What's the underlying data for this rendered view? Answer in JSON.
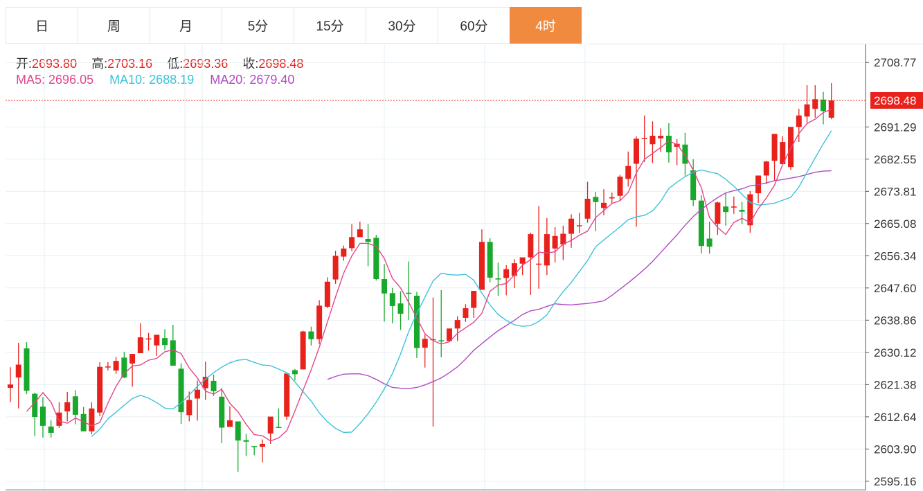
{
  "tabs": [
    {
      "label": "日"
    },
    {
      "label": "周"
    },
    {
      "label": "月"
    },
    {
      "label": "5分"
    },
    {
      "label": "15分"
    },
    {
      "label": "30分"
    },
    {
      "label": "60分"
    },
    {
      "label": "4时"
    }
  ],
  "active_tab": 7,
  "ohlc": {
    "open_label": "开:",
    "open": "2693.80",
    "high_label": "高:",
    "high": "2703.16",
    "low_label": "低:",
    "low": "2693.36",
    "close_label": "收:",
    "close": "2698.48"
  },
  "ma": {
    "ma5_label": "MA5:",
    "ma5": "2696.05",
    "ma10_label": "MA10:",
    "ma10": "2688.19",
    "ma20_label": "MA20:",
    "ma20": "2679.40"
  },
  "colors": {
    "up": "#e8211b",
    "down": "#18a82b",
    "ma5": "#e2478a",
    "ma10": "#3cc3d9",
    "ma20": "#b04bc4",
    "accent": "#f08a3e",
    "grid": "#e6eff4"
  },
  "chart_data": {
    "type": "candlestick",
    "y_ticks": [
      "2708.77",
      "2691.29",
      "2682.55",
      "2673.81",
      "2665.08",
      "2656.34",
      "2647.60",
      "2638.86",
      "2630.12",
      "2621.38",
      "2612.64",
      "2603.90",
      "2595.16"
    ],
    "ylim": [
      2592.7,
      2713.7
    ],
    "last_price": "2698.48",
    "candles": [
      [
        2620.5,
        2626.1,
        2616.6,
        2621.4
      ],
      [
        2623.3,
        2632.7,
        2614.9,
        2626.8
      ],
      [
        2631.2,
        2632.9,
        2618.8,
        2619.7
      ],
      [
        2618.9,
        2619.2,
        2607.4,
        2612.6
      ],
      [
        2615.4,
        2618.0,
        2607.0,
        2610.2
      ],
      [
        2610.0,
        2611.7,
        2607.0,
        2608.3
      ],
      [
        2610.2,
        2616.6,
        2609.6,
        2613.8
      ],
      [
        2614.1,
        2619.4,
        2611.4,
        2616.6
      ],
      [
        2618.2,
        2619.9,
        2610.6,
        2613.2
      ],
      [
        2613.4,
        2615.3,
        2608.7,
        2608.7
      ],
      [
        2608.7,
        2616.6,
        2607.9,
        2614.9
      ],
      [
        2613.8,
        2627.5,
        2612.8,
        2626.2
      ],
      [
        2626.3,
        2627.5,
        2625.2,
        2626.3
      ],
      [
        2625.2,
        2628.9,
        2624.3,
        2627.8
      ],
      [
        2628.7,
        2630.3,
        2623.1,
        2623.3
      ],
      [
        2627.1,
        2629.7,
        2620.8,
        2629.7
      ],
      [
        2629.9,
        2638.0,
        2630.1,
        2634.2
      ],
      [
        2633.8,
        2635.4,
        2630.6,
        2633.9
      ],
      [
        2632.0,
        2634.9,
        2629.2,
        2634.9
      ],
      [
        2634.0,
        2636.4,
        2630.8,
        2632.1
      ],
      [
        2633.4,
        2637.6,
        2630.6,
        2626.5
      ],
      [
        2625.7,
        2627.2,
        2610.7,
        2613.9
      ],
      [
        2613.1,
        2619.5,
        2611.4,
        2617.2
      ],
      [
        2617.6,
        2622.5,
        2611.6,
        2620.0
      ],
      [
        2620.4,
        2627.6,
        2617.2,
        2623.5
      ],
      [
        2622.4,
        2624.1,
        2618.3,
        2619.6
      ],
      [
        2618.1,
        2620.5,
        2605.5,
        2609.7
      ],
      [
        2609.9,
        2615.5,
        2610.1,
        2611.7
      ],
      [
        2611.4,
        2611.4,
        2597.7,
        2606.2
      ],
      [
        2606.3,
        2608.0,
        2602.0,
        2605.9
      ],
      [
        2604.7,
        2604.7,
        2602.2,
        2604.5
      ],
      [
        2604.5,
        2606.5,
        2600.3,
        2605.3
      ],
      [
        2608.1,
        2611.9,
        2605.3,
        2612.7
      ],
      [
        2609.9,
        2614.9,
        2609.6,
        2609.6
      ],
      [
        2612.7,
        2617.7,
        2611.8,
        2624.4
      ],
      [
        2625.3,
        2625.6,
        2622.5,
        2624.2
      ],
      [
        2625.5,
        2636.0,
        2625.5,
        2635.8
      ],
      [
        2635.8,
        2637.1,
        2632.0,
        2633.7
      ],
      [
        2633.7,
        2644.3,
        2632.3,
        2642.8
      ],
      [
        2642.5,
        2650.5,
        2642.1,
        2649.3
      ],
      [
        2649.9,
        2657.7,
        2648.7,
        2656.3
      ],
      [
        2656.1,
        2659.1,
        2655.0,
        2658.3
      ],
      [
        2658.4,
        2664.9,
        2657.6,
        2661.4
      ],
      [
        2661.4,
        2665.6,
        2661.4,
        2663.5
      ],
      [
        2660.9,
        2664.9,
        2653.5,
        2660.1
      ],
      [
        2661.2,
        2662.0,
        2649.6,
        2650.0
      ],
      [
        2650.0,
        2654.1,
        2638.5,
        2646.1
      ],
      [
        2646.2,
        2647.6,
        2638.0,
        2642.7
      ],
      [
        2643.4,
        2646.7,
        2636.2,
        2640.6
      ],
      [
        2646.3,
        2654.8,
        2638.9,
        2646.0
      ],
      [
        2645.5,
        2646.5,
        2628.6,
        2631.3
      ],
      [
        2631.4,
        2635.0,
        2626.0,
        2633.8
      ],
      [
        2633.6,
        2645.0,
        2610.0,
        2633.7
      ],
      [
        2633.4,
        2647.0,
        2628.8,
        2633.3
      ],
      [
        2633.2,
        2636.6,
        2633.2,
        2636.6
      ],
      [
        2636.6,
        2639.9,
        2633.2,
        2638.9
      ],
      [
        2639.5,
        2643.2,
        2638.4,
        2642.1
      ],
      [
        2642.2,
        2646.6,
        2639.5,
        2646.8
      ],
      [
        2647.1,
        2663.5,
        2647.1,
        2660.1
      ],
      [
        2660.1,
        2661.1,
        2649.1,
        2650.4
      ],
      [
        2650.2,
        2654.5,
        2645.5,
        2649.9
      ],
      [
        2650.3,
        2653.8,
        2645.6,
        2652.7
      ],
      [
        2650.9,
        2655.4,
        2647.6,
        2654.3
      ],
      [
        2654.2,
        2655.7,
        2651.1,
        2655.9
      ],
      [
        2655.9,
        2662.6,
        2645.7,
        2662.2
      ],
      [
        2654.2,
        2669.8,
        2647.4,
        2654.2
      ],
      [
        2653.7,
        2666.6,
        2651.1,
        2662.2
      ],
      [
        2658.3,
        2664.1,
        2654.5,
        2661.7
      ],
      [
        2659.4,
        2664.5,
        2655.2,
        2662.3
      ],
      [
        2662.3,
        2667.6,
        2658.5,
        2666.4
      ],
      [
        2664.6,
        2668.0,
        2662.5,
        2664.6
      ],
      [
        2666.4,
        2676.4,
        2665.3,
        2671.8
      ],
      [
        2672.3,
        2673.7,
        2663.0,
        2670.9
      ],
      [
        2669.3,
        2674.4,
        2667.3,
        2670.7
      ],
      [
        2671.9,
        2673.5,
        2670.4,
        2672.2
      ],
      [
        2672.6,
        2678.3,
        2671.3,
        2677.8
      ],
      [
        2677.2,
        2684.6,
        2675.1,
        2680.7
      ],
      [
        2681.3,
        2688.7,
        2664.2,
        2688.1
      ],
      [
        2688.1,
        2694.4,
        2681.8,
        2688.3
      ],
      [
        2686.6,
        2692.8,
        2681.5,
        2688.9
      ],
      [
        2688.2,
        2690.9,
        2684.5,
        2688.9
      ],
      [
        2688.9,
        2692.3,
        2681.6,
        2684.4
      ],
      [
        2685.9,
        2688.0,
        2680.9,
        2686.7
      ],
      [
        2686.5,
        2689.7,
        2678.1,
        2681.3
      ],
      [
        2679.5,
        2682.5,
        2669.8,
        2671.4
      ],
      [
        2671.3,
        2672.8,
        2656.9,
        2659.0
      ],
      [
        2661.0,
        2665.6,
        2656.9,
        2658.8
      ],
      [
        2665.0,
        2671.0,
        2662.0,
        2670.8
      ],
      [
        2669.7,
        2673.5,
        2664.5,
        2668.2
      ],
      [
        2669.6,
        2672.4,
        2667.7,
        2669.7
      ],
      [
        2668.8,
        2671.0,
        2664.9,
        2668.3
      ],
      [
        2664.6,
        2673.9,
        2662.6,
        2673.0
      ],
      [
        2673.3,
        2677.1,
        2670.6,
        2678.1
      ],
      [
        2678.1,
        2682.1,
        2675.8,
        2681.9
      ],
      [
        2682.1,
        2688.8,
        2676.7,
        2689.4
      ],
      [
        2681.2,
        2688.8,
        2681.2,
        2687.2
      ],
      [
        2680.4,
        2690.4,
        2679.6,
        2691.3
      ],
      [
        2691.3,
        2696.2,
        2687.2,
        2694.4
      ],
      [
        2694.1,
        2702.6,
        2692.4,
        2697.4
      ],
      [
        2696.2,
        2702.6,
        2693.8,
        2698.8
      ],
      [
        2698.7,
        2700.8,
        2692.0,
        2695.6
      ],
      [
        2693.8,
        2703.16,
        2693.36,
        2698.48
      ]
    ],
    "ma5": [
      2614.1,
      2616.5,
      2619.2,
      2616.6,
      2611.5,
      2610.9,
      2612.3,
      2611.3,
      2610.2,
      2611.1,
      2616.4,
      2620.9,
      2624.4,
      2626.4,
      2626.7,
      2628.0,
      2628.5,
      2630.3,
      2630.8,
      2629.8,
      2625.9,
      2623.2,
      2619.6,
      2618.8,
      2620.1,
      2616.3,
      2614.0,
      2610.6,
      2607.8,
      2607.5,
      2606.1,
      2606.9,
      2608.9,
      2614.2,
      2619.8,
      2625.4,
      2631.5,
      2638.4,
      2645.2,
      2651.6,
      2656.3,
      2659.7,
      2659.7,
      2658.9,
      2655.6,
      2650.2,
      2647.6,
      2643.7,
      2639.4,
      2635.2,
      2633.3,
      2632.4,
      2633.0,
      2635.3,
      2636.8,
      2638.3,
      2640.7,
      2646.7,
      2648.4,
      2648.8,
      2651.1,
      2653.8,
      2655.3,
      2657.3,
      2657.1,
      2657.4,
      2659.5,
      2660.5,
      2661.9,
      2663.0,
      2666.7,
      2668.6,
      2670.5,
      2671.3,
      2673.5,
      2678.8,
      2682.5,
      2684.1,
      2685.7,
      2687.5,
      2686.5,
      2683.7,
      2679.5,
      2674.8,
      2666.7,
      2664.0,
      2662.1,
      2665.4,
      2666.5,
      2665.3,
      2669.1,
      2672.0,
      2675.5,
      2681.1,
      2685.5,
      2689.5,
      2692.2,
      2693.4,
      2695.2,
      2696.05
    ],
    "ma10": [
      2607.3,
      2609.3,
      2612.1,
      2613.9,
      2615.8,
      2617.6,
      2618.5,
      2617.7,
      2616.5,
      2615.0,
      2614.8,
      2616.4,
      2618.6,
      2620.9,
      2622.9,
      2624.6,
      2626.1,
      2627.3,
      2628.0,
      2628.2,
      2627.4,
      2626.7,
      2626.5,
      2625.6,
      2624.6,
      2622.1,
      2619.5,
      2616.9,
      2613.7,
      2611.3,
      2609.5,
      2608.4,
      2608.5,
      2610.8,
      2613.5,
      2616.6,
      2620.2,
      2624.4,
      2629.7,
      2635.8,
      2640.7,
      2645.1,
      2649.5,
      2651.6,
      2651.2,
      2651.1,
      2651.3,
      2649.7,
      2646.2,
      2643.0,
      2640.4,
      2638.8,
      2637.6,
      2637.2,
      2637.4,
      2638.5,
      2640.3,
      2643.7,
      2646.6,
      2649.1,
      2652.1,
      2655.0,
      2658.8,
      2660.6,
      2662.4,
      2664.2,
      2666.1,
      2666.9,
      2667.3,
      2668.5,
      2671.1,
      2674.6,
      2676.3,
      2677.8,
      2679.0,
      2679.6,
      2679.1,
      2678.6,
      2677.1,
      2675.2,
      2673.0,
      2670.8,
      2670.1,
      2670.3,
      2670.6,
      2671.4,
      2672.2,
      2675.0,
      2679.0,
      2682.9,
      2686.7,
      2690.25
    ],
    "ma20": [
      2622.8,
      2623.6,
      2624.2,
      2624.3,
      2624.3,
      2623.8,
      2622.8,
      2621.6,
      2620.6,
      2620.4,
      2620.3,
      2620.6,
      2621.3,
      2622.2,
      2623.2,
      2624.6,
      2626.2,
      2628.3,
      2630.7,
      2632.5,
      2634.3,
      2636.0,
      2637.4,
      2638.8,
      2640.4,
      2641.4,
      2641.8,
      2642.6,
      2643.3,
      2643.1,
      2643.0,
      2643.2,
      2643.4,
      2643.7,
      2644.1,
      2645.6,
      2647.3,
      2649.0,
      2650.8,
      2652.7,
      2654.8,
      2657.2,
      2659.6,
      2662.0,
      2664.6,
      2667.0,
      2668.9,
      2670.6,
      2672.1,
      2673.4,
      2674.0,
      2674.5,
      2675.3,
      2675.6,
      2676.1,
      2676.7,
      2677.0,
      2677.4,
      2677.8,
      2678.4,
      2679.0,
      2679.3,
      2679.4
    ]
  }
}
